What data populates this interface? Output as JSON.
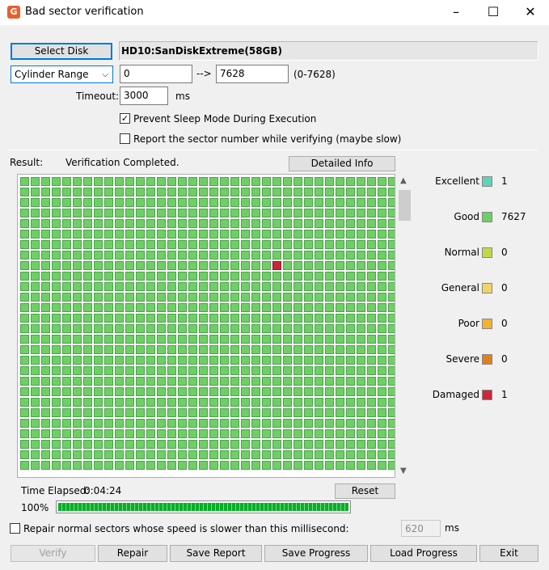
{
  "window": {
    "title": "Bad sector verification"
  },
  "disk": {
    "select_label": "Select Disk",
    "name": "HD10:SanDiskExtreme(58GB)"
  },
  "range": {
    "mode": "Cylinder Range",
    "start": "0",
    "arrow": "-->",
    "end": "7628",
    "range_hint": "(0-7628)"
  },
  "timeout": {
    "label": "Timeout:",
    "value": "3000",
    "unit": "ms"
  },
  "options": {
    "prevent_sleep": {
      "label": "Prevent Sleep Mode During Execution",
      "checked": true
    },
    "report_sector": {
      "label": "Report the sector number while verifying (maybe slow)",
      "checked": false
    }
  },
  "result": {
    "label": "Result:",
    "status": "Verification Completed.",
    "details_button": "Detailed Info"
  },
  "grid": {
    "cols": 36,
    "rows": 28,
    "colors": {
      "good": "#6fcf66",
      "good_border": "#4aa34a",
      "damaged": "#c8283a",
      "damaged_border": "#8a1824"
    },
    "damaged_cells": [
      [
        24,
        8
      ]
    ]
  },
  "legend": [
    {
      "name": "Excellent",
      "count": "1",
      "color": "#5fd3b5"
    },
    {
      "name": "Good",
      "count": "7627",
      "color": "#6fcf66"
    },
    {
      "name": "Normal",
      "count": "0",
      "color": "#c2d84a"
    },
    {
      "name": "General",
      "count": "0",
      "color": "#f0d46a"
    },
    {
      "name": "Poor",
      "count": "0",
      "color": "#f2b233"
    },
    {
      "name": "Severe",
      "count": "0",
      "color": "#e0801a"
    },
    {
      "name": "Damaged",
      "count": "1",
      "color": "#c8283a"
    }
  ],
  "elapsed": {
    "label": "Time Elapsed:",
    "value": "0:04:24",
    "reset_label": "Reset"
  },
  "progress": {
    "percent_label": "100%",
    "value": 1.0
  },
  "repair": {
    "label": "Repair normal sectors whose speed is slower than this millisecond:",
    "checked": false,
    "value": "620",
    "unit": "ms"
  },
  "buttons": {
    "verify": "Verify",
    "repair": "Repair",
    "save_report": "Save Report",
    "save_progress": "Save Progress",
    "load_progress": "Load Progress",
    "exit": "Exit"
  }
}
